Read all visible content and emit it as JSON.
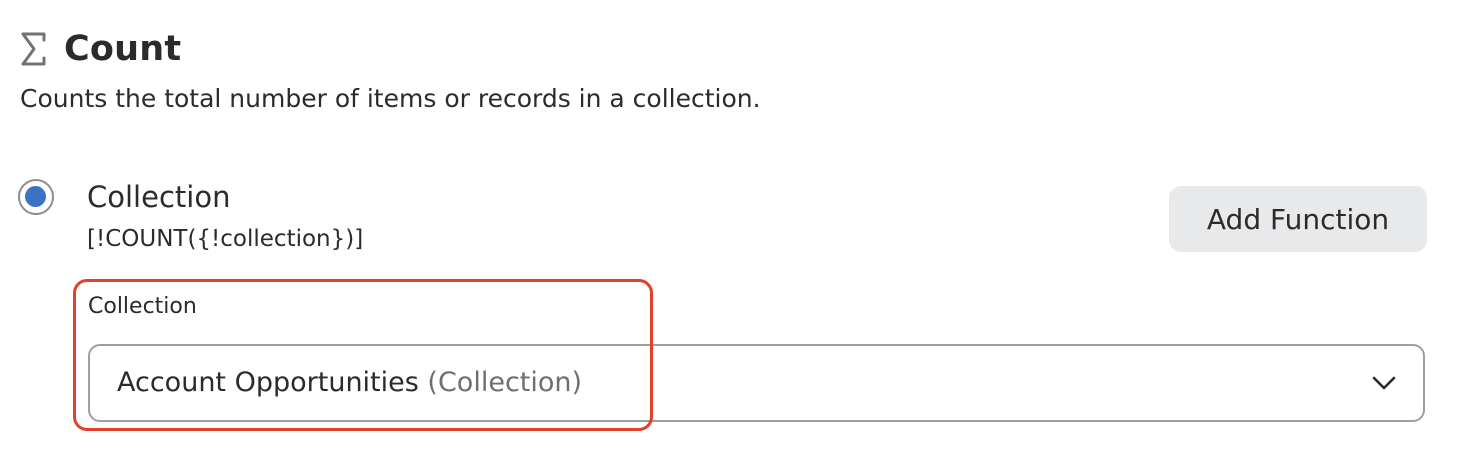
{
  "header": {
    "icon": "sigma-icon",
    "title": "Count"
  },
  "description": "Counts the total number of items or records in a collection.",
  "option": {
    "selected": true,
    "label": "Collection",
    "formula": "[!COUNT({!collection})]"
  },
  "add_function_label": "Add Function",
  "field": {
    "label": "Collection",
    "value": "Account Opportunities",
    "value_type": "(Collection)",
    "icon": "chevron-down-icon"
  },
  "colors": {
    "radio_selected": "#3a73c4",
    "highlight_border": "#e0412c",
    "button_bg": "#e8e9ea"
  }
}
